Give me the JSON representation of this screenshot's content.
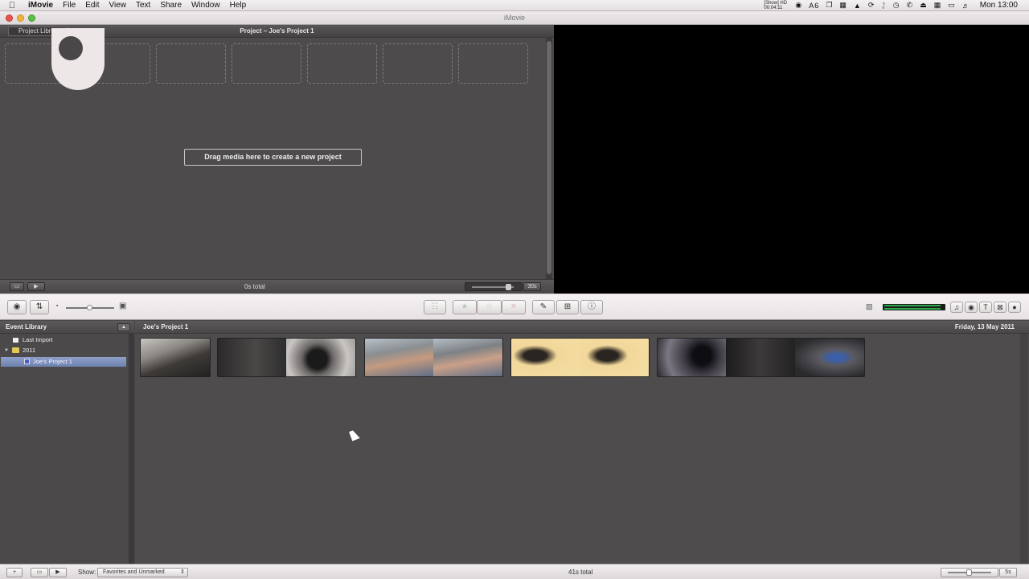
{
  "menubar": {
    "app_name": "iMovie",
    "items": [
      "File",
      "Edit",
      "View",
      "Text",
      "Share",
      "Window",
      "Help"
    ],
    "status_badge": "6",
    "status_text": "[Show] HD 00:04:11",
    "clock": "Mon 13:00"
  },
  "window": {
    "title": "iMovie"
  },
  "project": {
    "back_label": "Project Library",
    "title": "Project – Joe's Project 1",
    "drop_hint": "Drag media here to create a new project",
    "total": "0s total",
    "zoom_label": "30s"
  },
  "event_library": {
    "header": "Event Library",
    "items": [
      {
        "label": "Last Import"
      },
      {
        "label": "2011"
      },
      {
        "label": "Joe's Project 1"
      }
    ]
  },
  "event_browser": {
    "title": "Joe's Project 1",
    "date": "Friday, 13 May 2011",
    "clips": [
      {
        "name": "clip-mixing-desk",
        "frames": 1
      },
      {
        "name": "clip-camcorder",
        "frames": 2
      },
      {
        "name": "clip-camera-hands",
        "frames": 2
      },
      {
        "name": "clip-card-reader",
        "frames": 2
      },
      {
        "name": "clip-studio",
        "frames": 3
      }
    ]
  },
  "bottom": {
    "show_label": "Show:",
    "filter_value": "Favorites and Unmarked",
    "total": "41s total",
    "zoom_label": "5s"
  },
  "colors": {
    "accent_selection": "#7d90bf",
    "panel": "#4a4748",
    "viewer": "#000000"
  }
}
